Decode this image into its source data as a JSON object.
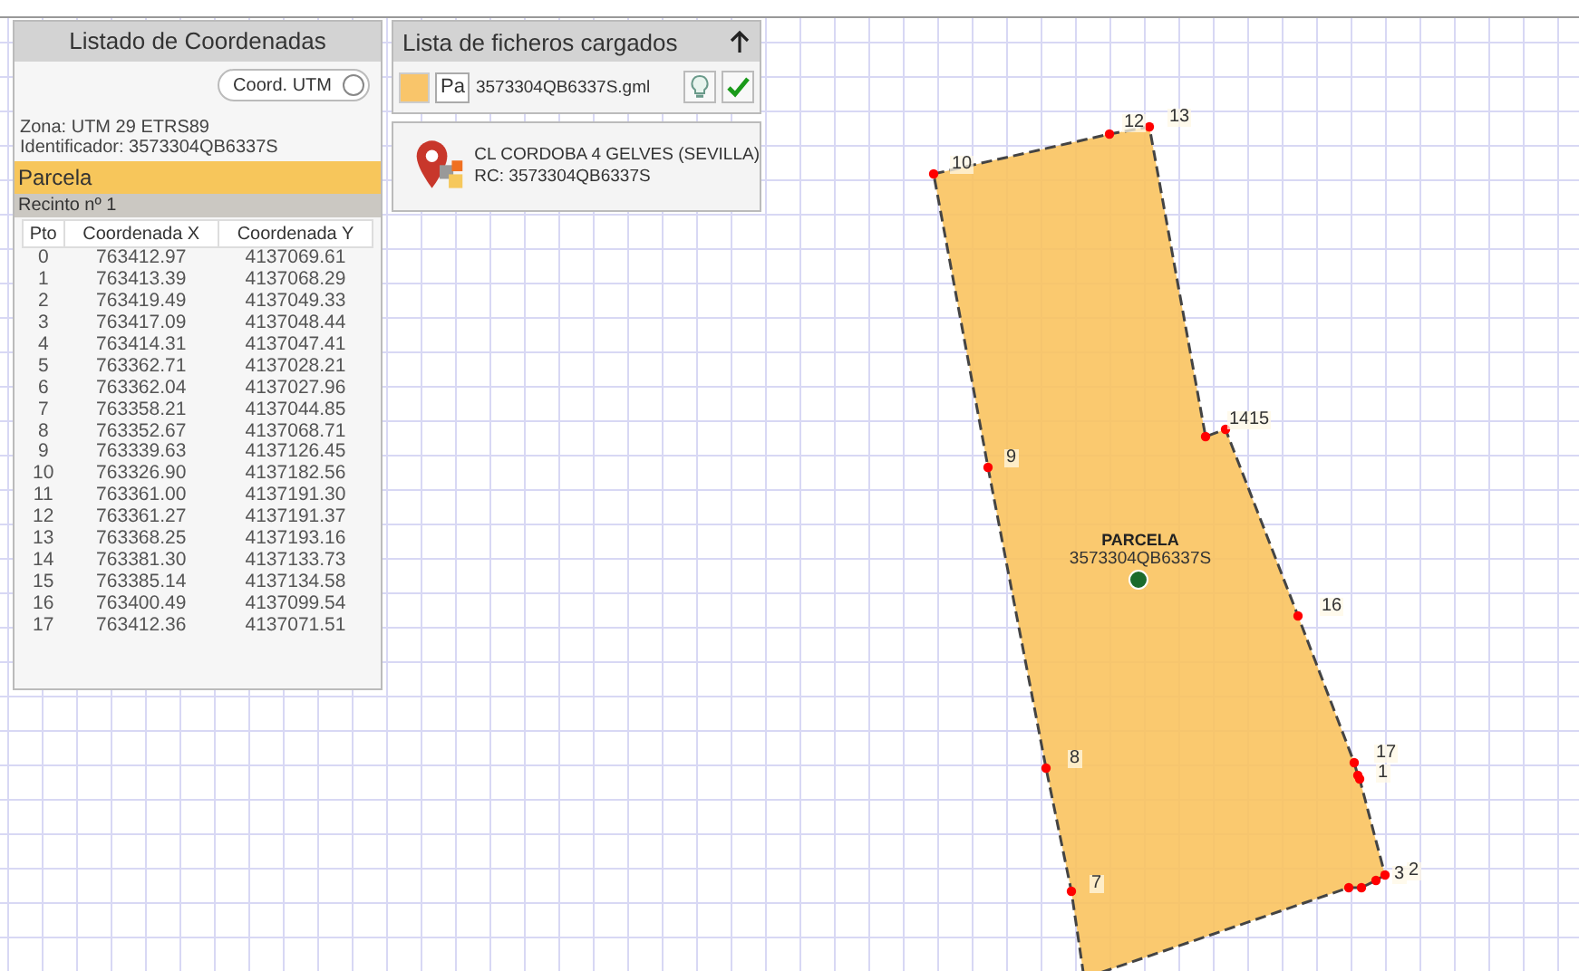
{
  "coord_panel": {
    "title": "Listado de Coordenadas",
    "toggle": {
      "label": "Coord. UTM",
      "on": false
    },
    "zone": "Zona: UTM 29 ETRS89",
    "identifier": "Identificador: 3573304QB6337S",
    "parcel_title": "Parcela",
    "enclosure_title": "Recinto nº 1",
    "table": {
      "columns": [
        "Pto",
        "Coordenada X",
        "Coordenada Y"
      ],
      "rows": [
        [
          "0",
          "763412.97",
          "4137069.61"
        ],
        [
          "1",
          "763413.39",
          "4137068.29"
        ],
        [
          "2",
          "763419.49",
          "4137049.33"
        ],
        [
          "3",
          "763417.09",
          "4137048.44"
        ],
        [
          "4",
          "763414.31",
          "4137047.41"
        ],
        [
          "5",
          "763362.71",
          "4137028.21"
        ],
        [
          "6",
          "763362.04",
          "4137027.96"
        ],
        [
          "7",
          "763358.21",
          "4137044.85"
        ],
        [
          "8",
          "763352.67",
          "4137068.71"
        ],
        [
          "9",
          "763339.63",
          "4137126.45"
        ],
        [
          "10",
          "763326.90",
          "4137182.56"
        ],
        [
          "11",
          "763361.00",
          "4137191.30"
        ],
        [
          "12",
          "763361.27",
          "4137191.37"
        ],
        [
          "13",
          "763368.25",
          "4137193.16"
        ],
        [
          "14",
          "763381.30",
          "4137133.73"
        ],
        [
          "15",
          "763385.14",
          "4137134.58"
        ],
        [
          "16",
          "763400.49",
          "4137099.54"
        ],
        [
          "17",
          "763412.36",
          "4137071.51"
        ]
      ]
    }
  },
  "files_panel": {
    "title": "Lista de ficheros cargados",
    "files": [
      {
        "color": "#f9c56a",
        "tag": "Pa",
        "name": "3573304QB6337S.gml",
        "validated": true
      }
    ],
    "info": {
      "address": "CL CORDOBA 4 GELVES (SEVILLA)",
      "rc": "RC: 3573304QB6337S"
    }
  },
  "map": {
    "parcel_name": "PARCELA",
    "parcel_id": "3573304QB6337S",
    "vertex_labels": [
      "10",
      "12",
      "13",
      "14",
      "15",
      "9",
      "16",
      "17",
      "1",
      "8",
      "7",
      "3",
      "2"
    ]
  }
}
